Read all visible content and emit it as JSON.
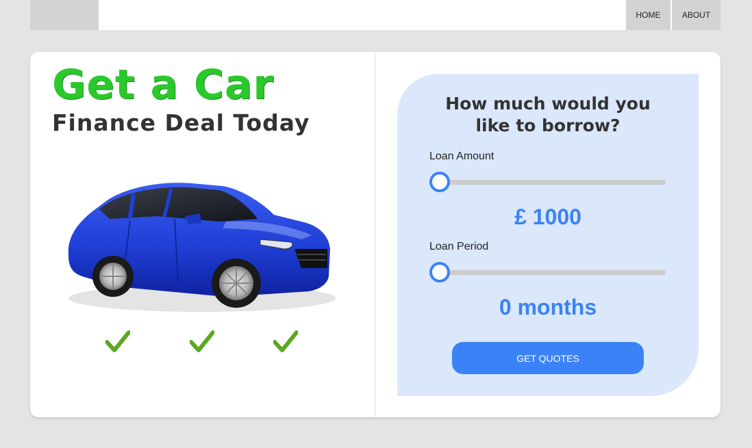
{
  "nav": {
    "home_label": "HOME",
    "about_label": "ABOUT"
  },
  "hero": {
    "title": "Get a Car",
    "subtitle": "Finance Deal Today",
    "car_image": "blue-hatchback-car",
    "check_icons": [
      "checkmark-icon",
      "checkmark-icon",
      "checkmark-icon"
    ]
  },
  "loan_form": {
    "question": "How much would you like to borrow?",
    "amount_label": "Loan Amount",
    "amount_value": "£ 1000",
    "amount_slider_fraction": 0,
    "period_label": "Loan Period",
    "period_value": "0 months",
    "period_slider_fraction": 0,
    "submit_label": "GET QUOTES"
  },
  "colors": {
    "accent_blue": "#3b82f6",
    "title_green": "#2bc82b",
    "panel_bg": "#dbe7fa",
    "check_green": "#5aa81e"
  }
}
